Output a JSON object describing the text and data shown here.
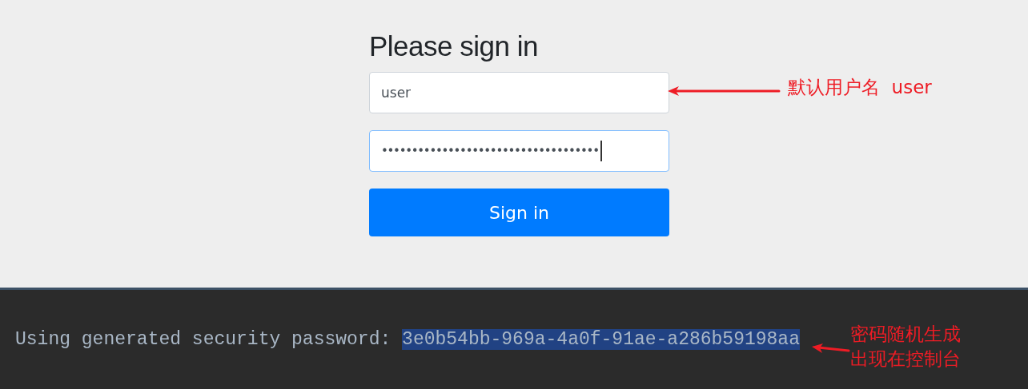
{
  "login_form": {
    "title": "Please sign in",
    "username": {
      "value": "user"
    },
    "password": {
      "value": "••••••••••••••••••••••••••••••••••••",
      "focused": true
    },
    "submit_button": "Sign in"
  },
  "console": {
    "label": "Using generated security password: ",
    "password": "3e0b54bb-969a-4a0f-91ae-a286b59198aa",
    "password_selected": true
  },
  "annotations": [
    {
      "kind": "username",
      "text": "默认用户名  user"
    },
    {
      "kind": "console",
      "text": "密码随机生成出现在控制台"
    }
  ]
}
